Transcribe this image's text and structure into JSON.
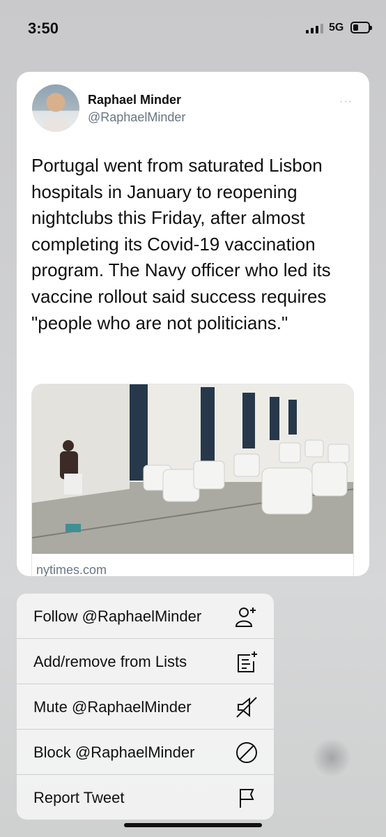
{
  "status_bar": {
    "time": "3:50",
    "network": "5G"
  },
  "tweet": {
    "author_name": "Raphael Minder",
    "author_handle": "@RaphaelMinder",
    "more_label": "···",
    "text": "Portugal went from saturated Lisbon hospitals in January to reopening nightclubs this Friday, after almost completing its Covid-19 vaccination program. The Navy officer who led its vaccine rollout said success requires \"people who are not politicians.\"",
    "link_domain": "nytimes.com"
  },
  "menu": {
    "items": [
      {
        "label": "Follow @RaphaelMinder",
        "icon": "follow-user-icon"
      },
      {
        "label": "Add/remove from Lists",
        "icon": "list-add-icon"
      },
      {
        "label": "Mute @RaphaelMinder",
        "icon": "mute-speaker-icon"
      },
      {
        "label": "Block @RaphaelMinder",
        "icon": "block-icon"
      },
      {
        "label": "Report Tweet",
        "icon": "flag-icon"
      }
    ]
  }
}
